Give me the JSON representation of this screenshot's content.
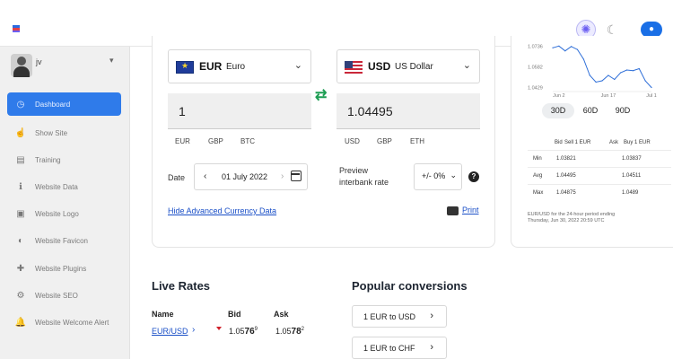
{
  "header": {
    "theme_light_icon": "sun-icon",
    "theme_dark_icon": "moon-icon",
    "preview_icon": "eye-icon",
    "accent": "#1a6fe6"
  },
  "sidebar": {
    "user": {
      "name": "jv"
    },
    "items": [
      {
        "label": "Dashboard",
        "icon": "gauge-icon",
        "glyph": "◷",
        "active": true
      },
      {
        "label": "Show Site",
        "icon": "pointer-icon",
        "glyph": "☝"
      },
      {
        "label": "Training",
        "icon": "training-icon",
        "glyph": "▤"
      },
      {
        "label": "Website Data",
        "icon": "info-icon",
        "glyph": "ℹ"
      },
      {
        "label": "Website Logo",
        "icon": "image-icon",
        "glyph": "▣"
      },
      {
        "label": "Website Favicon",
        "icon": "contrast-icon",
        "glyph": "◐"
      },
      {
        "label": "Website Plugins",
        "icon": "puzzle-icon",
        "glyph": "✚"
      },
      {
        "label": "Website SEO",
        "icon": "gear-icon",
        "glyph": "⚙"
      },
      {
        "label": "Website Welcome Alert",
        "icon": "bell-icon",
        "glyph": "🔔"
      }
    ]
  },
  "converter": {
    "from": {
      "code": "EUR",
      "name": "Euro",
      "amount": "1",
      "quick": [
        "EUR",
        "GBP",
        "BTC"
      ]
    },
    "to": {
      "code": "USD",
      "name": "US Dollar",
      "amount": "1.04495",
      "quick": [
        "USD",
        "GBP",
        "ETH"
      ]
    },
    "date_label": "Date",
    "date_value": "01 July 2022",
    "preview_label": "Preview interbank rate",
    "spread_value": "+/- 0%",
    "hide_link": "Hide Advanced Currency Data",
    "print_link": "Print"
  },
  "rate_chart": {
    "ranges": [
      "30D",
      "60D",
      "90D"
    ],
    "active_range": "30D",
    "stats_headers": {
      "bid": "Bid",
      "sell": "Sell 1 EUR",
      "ask": "Ask",
      "buy": "Buy 1 EUR"
    },
    "stats": [
      {
        "label": "Min",
        "bid": "1.03821",
        "ask": "1.03837"
      },
      {
        "label": "Avg",
        "bid": "1.04495",
        "ask": "1.04511"
      },
      {
        "label": "Max",
        "bid": "1.04875",
        "ask": "1.0489"
      }
    ],
    "note_line1": "EUR/USD for the 24-hour period ending",
    "note_line2": "Thursday, Jun 30, 2022 20:59 UTC"
  },
  "chart_data": {
    "type": "line",
    "x": [
      "Jun 1",
      "Jun 2",
      "Jun 4",
      "Jun 6",
      "Jun 8",
      "Jun 10",
      "Jun 12",
      "Jun 14",
      "Jun 16",
      "Jun 17",
      "Jun 19",
      "Jun 21",
      "Jun 23",
      "Jun 25",
      "Jun 27",
      "Jun 29",
      "Jul 1"
    ],
    "series": [
      {
        "values": [
          1.0725,
          1.0738,
          1.0702,
          1.0735,
          1.0712,
          1.064,
          1.052,
          1.047,
          1.048,
          1.052,
          1.049,
          1.054,
          1.056,
          1.0555,
          1.057,
          1.048,
          1.043
        ]
      }
    ],
    "y_ticks": [
      "1.0736",
      "1.0582",
      "1.0429"
    ],
    "x_ticks": [
      "Jun 2",
      "Jun 17",
      "Jul 1"
    ],
    "ylim": [
      1.04,
      1.076
    ],
    "line_color": "#2f6fd8"
  },
  "live_rates": {
    "title": "Live Rates",
    "headers": {
      "name": "Name",
      "bid": "Bid",
      "ask": "Ask"
    },
    "rows": [
      {
        "pair": "EUR/USD",
        "bid": "1.05769",
        "ask": "1.05782",
        "trend": "down"
      }
    ]
  },
  "popular": {
    "title": "Popular conversions",
    "items": [
      "1 EUR to USD",
      "1 EUR to CHF"
    ]
  }
}
